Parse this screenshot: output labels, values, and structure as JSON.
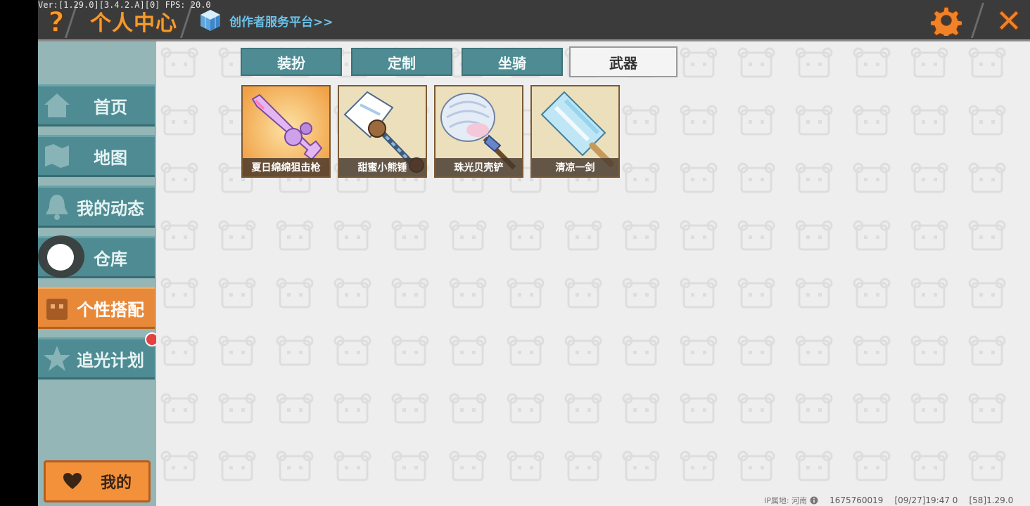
{
  "window": {
    "version_info": "Ver:[1.29.0][3.4.2.A][0] FPS: 20.0"
  },
  "header": {
    "title": "个人中心",
    "creator_link": "创作者服务平台>>",
    "icons": {
      "help": "question-icon",
      "settings": "gear-icon",
      "close": "close-x-icon",
      "creator": "cube-icon"
    }
  },
  "sidebar": {
    "items": [
      {
        "label": "首页",
        "icon": "home-icon"
      },
      {
        "label": "地图",
        "icon": "map-icon"
      },
      {
        "label": "我的动态",
        "icon": "bell-icon"
      },
      {
        "label": "仓库",
        "icon": "box-icon"
      },
      {
        "label": "个性搭配",
        "icon": "outfit-icon",
        "active": true
      },
      {
        "label": "追光计划",
        "icon": "star-icon",
        "badge": "red-dot"
      }
    ],
    "mine_button": "我的"
  },
  "tabs": [
    {
      "label": "装扮"
    },
    {
      "label": "定制"
    },
    {
      "label": "坐骑"
    },
    {
      "label": "武器",
      "active": true
    }
  ],
  "items": [
    {
      "name": "夏日绵绵狙击枪",
      "bg": "#f3b156"
    },
    {
      "name": "甜蜜小熊锤",
      "bg": "#ecdfba"
    },
    {
      "name": "珠光贝壳铲",
      "bg": "#ecdfba"
    },
    {
      "name": "清凉一剑",
      "bg": "#ecdfba"
    }
  ],
  "footer": {
    "ip_label": "IP属地: 河南",
    "uid": "1675760019",
    "time": "[09/27]19:47 0",
    "build": "[58]1.29.0"
  },
  "colors": {
    "accent_orange": "#f49a2f",
    "teal": "#4e8b93",
    "sidebar_bg": "#94b6b6"
  }
}
